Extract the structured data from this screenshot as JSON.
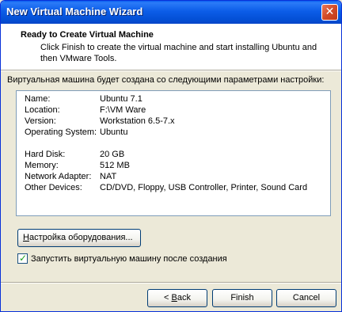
{
  "window": {
    "title": "New Virtual Machine Wizard"
  },
  "header": {
    "title": "Ready to Create Virtual Machine",
    "subtitle": "Click Finish to create the virtual machine and start installing Ubuntu and then VMware Tools."
  },
  "intro": "Виртуальная машина будет создана со следующими параметрами настройки:",
  "summary": [
    {
      "key": "Name:",
      "value": "Ubuntu 7.1"
    },
    {
      "key": "Location:",
      "value": "F:\\VM Ware"
    },
    {
      "key": "Version:",
      "value": "Workstation 6.5-7.x"
    },
    {
      "key": "Operating System:",
      "value": "Ubuntu"
    },
    {
      "key": "Hard Disk:",
      "value": "20 GB"
    },
    {
      "key": "Memory:",
      "value": "512 MB"
    },
    {
      "key": "Network Adapter:",
      "value": "NAT"
    },
    {
      "key": "Other Devices:",
      "value": "CD/DVD, Floppy, USB Controller, Printer, Sound Card"
    }
  ],
  "customize_button": {
    "accel": "Н",
    "rest": "астройка оборудования..."
  },
  "power_on_checkbox": {
    "label": "Запустить виртуальную машину после создания",
    "checked": true
  },
  "buttons": {
    "back_prefix": "< ",
    "back_accel": "B",
    "back_rest": "ack",
    "finish": "Finish",
    "cancel": "Cancel"
  }
}
